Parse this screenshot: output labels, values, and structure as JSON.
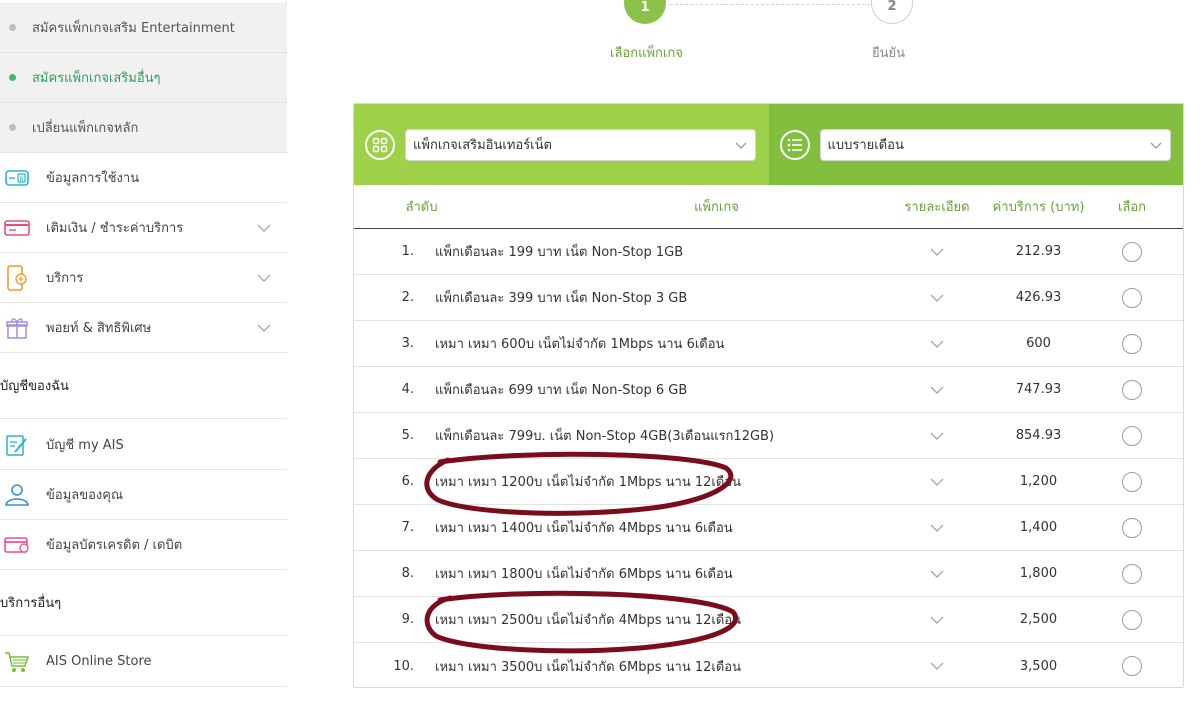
{
  "sidebar": {
    "sub_items": [
      {
        "label": "สมัครแพ็กเกจเสริม Entertainment",
        "active": false
      },
      {
        "label": "สมัครแพ็กเกจเสริมอื่นๆ",
        "active": true
      },
      {
        "label": "เปลี่ยนแพ็กเกจหลัก",
        "active": false
      }
    ],
    "menu_items": [
      {
        "label": "ข้อมูลการใช้งาน",
        "icon": "usage-card-icon"
      },
      {
        "label": "เติมเงิน / ชำระค่าบริการ",
        "icon": "payment-card-icon"
      },
      {
        "label": "บริการ",
        "icon": "phone-service-icon"
      },
      {
        "label": "พอยท์ & สิทธิพิเศษ",
        "icon": "gift-icon"
      }
    ],
    "section_my_account": "บัญชีของฉัน",
    "account_items": [
      {
        "label": "บัญชี my AIS",
        "icon": "edit-account-icon"
      },
      {
        "label": "ข้อมูลของคุณ",
        "icon": "user-icon"
      },
      {
        "label": "ข้อมูลบัตรเครดิต / เดบิต",
        "icon": "credit-card-icon"
      }
    ],
    "section_other": "บริการอื่นๆ",
    "other_items": [
      {
        "label": "AIS Online Store",
        "icon": "cart-icon"
      }
    ]
  },
  "steps": {
    "step1_number": "1",
    "step1_label": "เลือกแพ็กเกจ",
    "step2_number": "2",
    "step2_label": "ยืนยัน"
  },
  "filters": {
    "category_value": "แพ็กเกจเสริมอินเทอร์เน็ต",
    "period_value": "แบบรายเดือน"
  },
  "table": {
    "headers": {
      "no": "ลำดับ",
      "package": "แพ็กเกจ",
      "detail": "รายละเอียด",
      "price": "ค่าบริการ (บาท)",
      "select": "เลือก"
    },
    "rows": [
      {
        "no": "1.",
        "name": "แพ็กเดือนละ 199 บาท เน็ต Non-Stop 1GB",
        "price": "212.93"
      },
      {
        "no": "2.",
        "name": "แพ็กเดือนละ 399 บาท เน็ต Non-Stop 3 GB",
        "price": "426.93"
      },
      {
        "no": "3.",
        "name": "เหมา เหมา 600บ เน็ตไม่จำกัด 1Mbps นาน 6เดือน",
        "price": "600"
      },
      {
        "no": "4.",
        "name": "แพ็กเดือนละ 699 บาท เน็ต Non-Stop 6 GB",
        "price": "747.93"
      },
      {
        "no": "5.",
        "name": "แพ็กเดือนละ 799บ. เน็ต Non-Stop 4GB(3เดือนแรก12GB)",
        "price": "854.93"
      },
      {
        "no": "6.",
        "name": "เหมา เหมา 1200บ เน็ตไม่จำกัด 1Mbps นาน 12เดือน",
        "price": "1,200"
      },
      {
        "no": "7.",
        "name": "เหมา เหมา 1400บ เน็ตไม่จำกัด 4Mbps นาน 6เดือน",
        "price": "1,400"
      },
      {
        "no": "8.",
        "name": "เหมา เหมา 1800บ เน็ตไม่จำกัด 6Mbps นาน 6เดือน",
        "price": "1,800"
      },
      {
        "no": "9.",
        "name": "เหมา เหมา 2500บ เน็ตไม่จำกัด 4Mbps นาน 12เดือน",
        "price": "2,500"
      },
      {
        "no": "10.",
        "name": "เหมา เหมา 3500บ เน็ตไม่จำกัด 6Mbps นาน 12เดือน",
        "price": "3,500"
      }
    ]
  },
  "colors": {
    "green_light": "#9ed04a",
    "green_dark": "#82bf3f",
    "annotation": "#7a0d1c"
  }
}
